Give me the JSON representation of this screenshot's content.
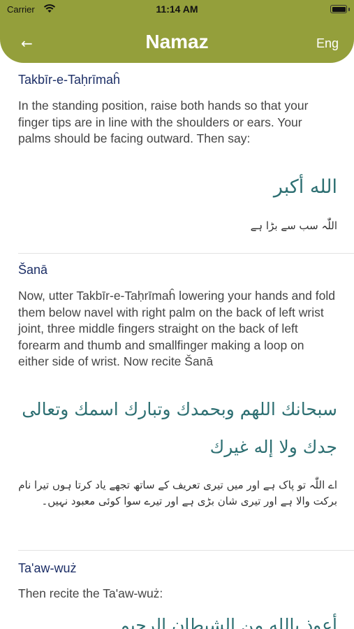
{
  "status": {
    "carrier": "Carrier",
    "time": "11:14 AM"
  },
  "header": {
    "back": "←",
    "title": "Namaz",
    "lang": "Eng"
  },
  "colors": {
    "header_bg": "#949f3b",
    "title_blue": "#1c2e66",
    "arabic_teal": "#2d6f72"
  },
  "sections": [
    {
      "title": "Takbīr-e-Taḥrīmaĥ",
      "text": "In the standing position, raise both hands so that your finger tips are in line with the shoulders or ears. Your palms should be facing outward. Then say:",
      "arabic": "الله أكبر",
      "urdu": "اللّٰہ سب سے بڑا ہے"
    },
    {
      "title": "Šanā",
      "text": "Now, utter Takbīr-e-Taḥrīmaĥ lowering your hands and fold them below navel with right palm on the back of left wrist joint, three middle fingers straight on the back of left forearm and thumb and smallfinger making a loop on either side of wrist. Now recite Šanā",
      "arabic_line1": "سبحانك اللهم وبحمدك وتبارك اسمك وتعالى",
      "arabic_line2": "جدك ولا إله غيرك",
      "urdu": "اے اللّٰہ تو پاک ہے اور میں تیری تعریف کے ساتھ تجھے یاد کرتا ہوں تیرا نام برکت والا ہے اور تیری شان بڑی ہے اور تیرے سوا کوئی معبود نہیں۔"
    },
    {
      "title": "Ta'aw-wuż",
      "text": "Then recite the Ta'aw-wuż:",
      "arabic": "أعوذ بالله من الشيطان الرجيم"
    }
  ]
}
